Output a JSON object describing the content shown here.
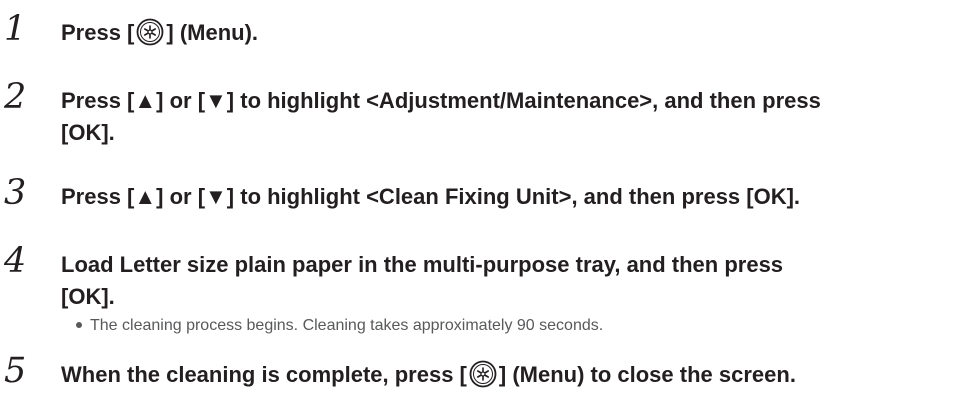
{
  "steps": [
    {
      "number": "1",
      "before_icon": "Press [",
      "after_icon": "] (Menu)."
    },
    {
      "number": "2",
      "line1": "Press [▲] or [▼] to highlight <Adjustment/Maintenance>, and then press",
      "line2": "[OK]."
    },
    {
      "number": "3",
      "line1": "Press [▲] or [▼] to highlight <Clean Fixing Unit>, and then press [OK]."
    },
    {
      "number": "4",
      "line1": "Load Letter size plain paper in the multi-purpose tray, and then press",
      "line2": "[OK].",
      "bullet": "The cleaning process begins. Cleaning takes approximately 90 seconds."
    },
    {
      "number": "5",
      "before_icon": "When the cleaning is complete, press [",
      "after_icon": "] (Menu) to close the screen."
    }
  ],
  "icons": {
    "menu_key": "menu-key-icon"
  }
}
